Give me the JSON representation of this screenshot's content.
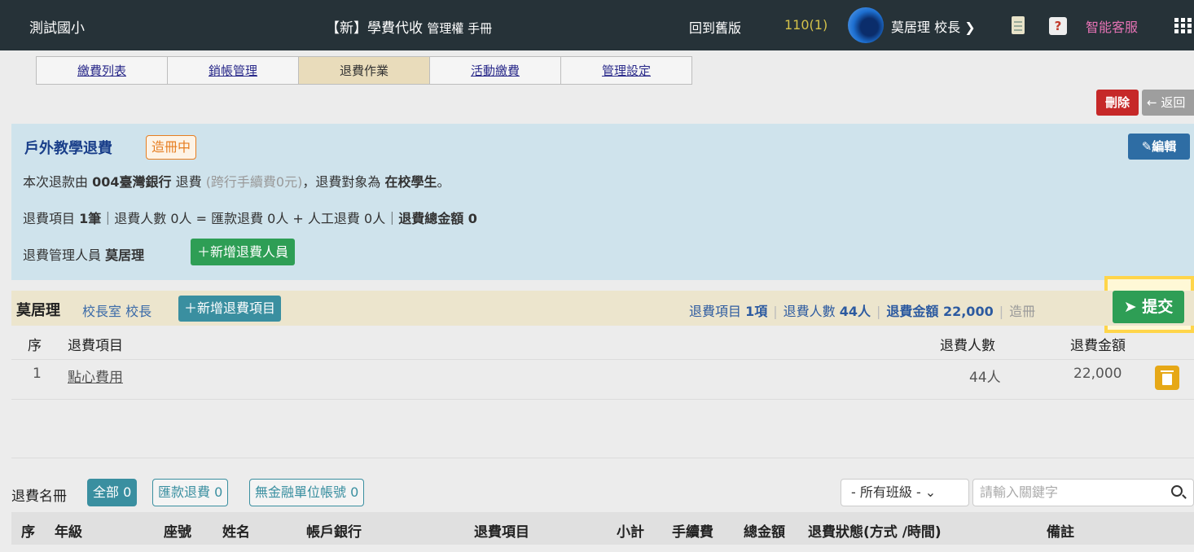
{
  "header": {
    "school": "測試國小",
    "system_title": "【新】學費代收",
    "system_sub": "管理權 手冊",
    "old_version": "回到舊版",
    "term": "110(1)",
    "user": "莫居理 校長",
    "support": "智能客服"
  },
  "tabs": [
    {
      "label": "繳費列表",
      "active": false
    },
    {
      "label": "銷帳管理",
      "active": false
    },
    {
      "label": "退費作業",
      "active": true
    },
    {
      "label": "活動繳費",
      "active": false
    },
    {
      "label": "管理設定",
      "active": false
    }
  ],
  "actions": {
    "delete": "刪除",
    "back": "← 返回"
  },
  "refund": {
    "title": "戶外教學退費",
    "status": "造冊中",
    "edit": "編輯",
    "line1": {
      "prefix": "本次退款由 ",
      "bank": "004臺灣銀行",
      "mid": " 退費 ",
      "fee_note": "(跨行手續費0元)",
      "suffix": "，退費對象為 ",
      "target": "在校學生",
      "end": "。"
    },
    "line2": {
      "items_label": "退費項目 ",
      "items_value": "1筆",
      "rest": "｜退費人數 0人 = 匯款退費 0人 + 人工退費 0人｜",
      "total_label": "退費總金額 0"
    },
    "line3": {
      "label": "退費管理人員 ",
      "manager": "莫居理"
    },
    "add_manager": "＋新增退費人員"
  },
  "owner": {
    "name": "莫居理",
    "role": "校長室 校長",
    "add_item": "＋新增退費項目",
    "stat_items_label": "退費項目 ",
    "stat_items_value": "1項",
    "stat_people_label": "退費人數 ",
    "stat_people_value": "44人",
    "stat_amount": "退費金額 22,000",
    "stat_trunc": "造冊",
    "submit": "提交"
  },
  "items_table": {
    "headers": {
      "seq": "序",
      "item": "退費項目",
      "people": "退費人數",
      "amount": "退費金額"
    },
    "rows": [
      {
        "seq": "1",
        "item": "點心費用",
        "people": "44人",
        "amount": "22,000"
      }
    ]
  },
  "roster": {
    "label": "退費名冊",
    "filters": [
      {
        "label": "全部 0",
        "active": true
      },
      {
        "label": "匯款退費 0",
        "active": false
      },
      {
        "label": "無金融單位帳號 0",
        "active": false
      }
    ],
    "class_select": "- 所有班級 - ⌄",
    "search_placeholder": "請輸入關鍵字",
    "headers": {
      "seq": "序",
      "grade": "年級",
      "seat": "座號",
      "name": "姓名",
      "bank": "帳戶銀行",
      "item": "退費項目",
      "subtotal": "小計",
      "fee": "手續費",
      "total": "總金額",
      "status": "退費狀態(方式 /時間)",
      "note": "備註"
    }
  }
}
